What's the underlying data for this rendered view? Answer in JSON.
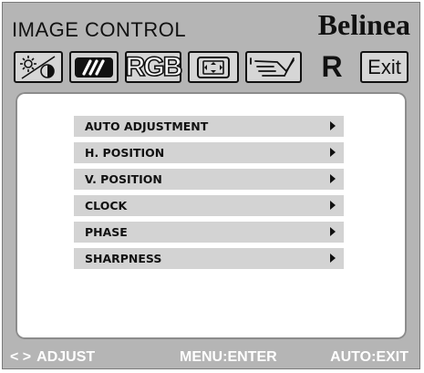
{
  "window": {
    "title": "IMAGE CONTROL",
    "brand": "Belinea"
  },
  "tabs": [
    {
      "name": "brightness-contrast",
      "icon": "brightness-contrast-icon"
    },
    {
      "name": "image-control",
      "icon": "image-control-icon",
      "active": true
    },
    {
      "name": "rgb",
      "label": "RGB"
    },
    {
      "name": "geometry",
      "icon": "geometry-icon"
    },
    {
      "name": "osd-setup",
      "icon": "osd-setup-icon"
    },
    {
      "name": "recall",
      "label": "R"
    },
    {
      "name": "exit",
      "label": "Exit"
    }
  ],
  "menu": {
    "items": [
      {
        "label": "AUTO ADJUSTMENT"
      },
      {
        "label": "H. POSITION"
      },
      {
        "label": "V. POSITION"
      },
      {
        "label": "CLOCK"
      },
      {
        "label": "PHASE"
      },
      {
        "label": "SHARPNESS"
      }
    ]
  },
  "footer": {
    "adjust_arrows": "< >",
    "adjust_label": "ADJUST",
    "menu_key": "MENU",
    "menu_action": "ENTER",
    "auto_key": "AUTO",
    "auto_action": "EXIT",
    "separator": ":"
  },
  "colors": {
    "frame": "#b5b5b5",
    "panel": "#ffffff",
    "menu_item": "#d3d3d3",
    "text": "#111111",
    "footer_text": "#ffffff"
  }
}
